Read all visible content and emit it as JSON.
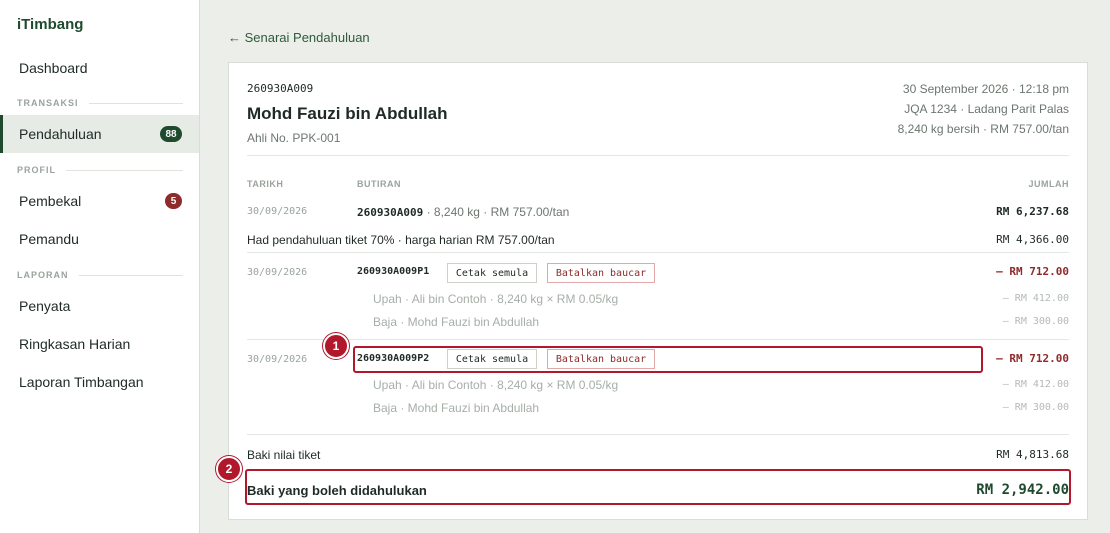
{
  "sidebar": {
    "brand": "iTimbang",
    "dashboard": "Dashboard",
    "sections": {
      "transaksi": "TRANSAKSI",
      "profil": "PROFIL",
      "laporan": "LAPORAN"
    },
    "items": {
      "pendahuluan": {
        "label": "Pendahuluan",
        "badge": "88"
      },
      "pembekal": {
        "label": "Pembekal",
        "badge": "5"
      },
      "pemandu": {
        "label": "Pemandu"
      },
      "penyata": {
        "label": "Penyata"
      },
      "ringkasan": {
        "label": "Ringkasan Harian"
      },
      "laporan_timbangan": {
        "label": "Laporan Timbangan"
      }
    }
  },
  "back_link": "← Senarai Pendahuluan",
  "ticket": {
    "id": "260930A009",
    "name": "Mohd Fauzi bin Abdullah",
    "member": "Ahli No. PPK-001",
    "datetime": "30 September 2026 · 12:18 pm",
    "vehicle": "JQA 1234 · Ladang Parit Palas",
    "weight": "8,240 kg bersih · RM 757.00/tan"
  },
  "table": {
    "headers": {
      "date": "TARIKH",
      "item": "BUTIRAN",
      "amount": "JUMLAH"
    },
    "ticket_row": {
      "date": "30/09/2026",
      "ticket": "260930A009",
      "detail": " · 8,240 kg · RM 757.00/tan",
      "amount": "RM 6,237.68"
    },
    "limit_row": {
      "text": "Had pendahuluan tiket 70% · harga harian RM 757.00/tan",
      "amount": "RM 4,366.00"
    },
    "vouchers": [
      {
        "date": "30/09/2026",
        "code": "260930A009P1",
        "reprint": "Cetak semula",
        "cancel": "Batalkan baucar",
        "amount": "– RM 712.00",
        "line1": "Upah · Ali bin Contoh · 8,240 kg × RM 0.05/kg",
        "line1_amount": "– RM 412.00",
        "line2": "Baja · Mohd Fauzi bin Abdullah",
        "line2_amount": "– RM 300.00"
      },
      {
        "date": "30/09/2026",
        "code": "260930A009P2",
        "reprint": "Cetak semula",
        "cancel": "Batalkan baucar",
        "amount": "– RM 712.00",
        "line1": "Upah · Ali bin Contoh · 8,240 kg × RM 0.05/kg",
        "line1_amount": "– RM 412.00",
        "line2": "Baja · Mohd Fauzi bin Abdullah",
        "line2_amount": "– RM 300.00"
      }
    ]
  },
  "summary": {
    "balance_label": "Baki nilai tiket",
    "balance_amount": "RM 4,813.68",
    "available_label": "Baki yang boleh didahulukan",
    "available_amount": "RM 2,942.00"
  },
  "markers": [
    "1",
    "2"
  ],
  "colors": {
    "brand": "#1f4a2e",
    "danger": "#8e2b2b",
    "highlight": "#b1182c"
  }
}
